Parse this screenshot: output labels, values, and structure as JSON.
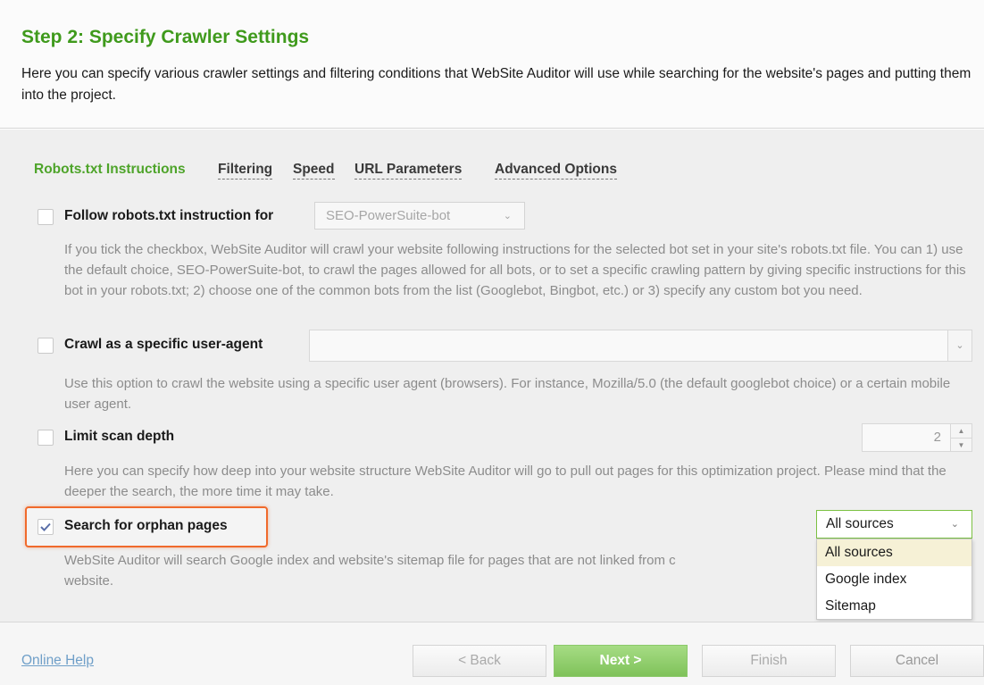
{
  "header": {
    "title": "Step 2: Specify Crawler Settings",
    "description": "Here you can specify various crawler settings and filtering conditions that WebSite Auditor will use while searching for the website's pages and putting them into the project."
  },
  "tabs": [
    {
      "label": "Robots.txt Instructions",
      "active": true
    },
    {
      "label": "Filtering",
      "active": false
    },
    {
      "label": "Speed",
      "active": false
    },
    {
      "label": "URL Parameters",
      "active": false
    },
    {
      "label": "Advanced Options",
      "active": false
    }
  ],
  "options": {
    "robots": {
      "label": "Follow robots.txt instruction for",
      "checked": false,
      "select_value": "SEO-PowerSuite-bot",
      "description": "If you tick the checkbox, WebSite Auditor will crawl your website following instructions for the selected bot set in your site's robots.txt file. You can 1) use the default choice, SEO-PowerSuite-bot, to crawl the pages allowed for all bots, or to set a specific crawling pattern by giving specific instructions for this bot in your robots.txt; 2) choose one of the common bots from the list (Googlebot, Bingbot, etc.) or 3) specify any custom bot you need."
    },
    "user_agent": {
      "label": "Crawl as a specific user-agent",
      "checked": false,
      "value": "",
      "description": "Use this option to crawl the website using a specific user agent (browsers). For instance, Mozilla/5.0 (the default googlebot choice) or a certain mobile user agent."
    },
    "scan_depth": {
      "label": "Limit scan depth",
      "checked": false,
      "value": "2",
      "description": "Here you can specify how deep into  your website structure WebSite Auditor will go to pull out pages for this optimization project. Please mind that the deeper the search, the more time it may take."
    },
    "orphan": {
      "label": "Search for orphan pages",
      "checked": true,
      "select_value": "All sources",
      "description_visible": "WebSite Auditor will search Google index and website's sitemap file for pages that are not linked from c",
      "description_line2": "website.",
      "dropdown_items": [
        "All sources",
        "Google index",
        "Sitemap"
      ],
      "selected_index": 0
    }
  },
  "footer": {
    "help_link": "Online Help",
    "back": "< Back",
    "next": "Next >",
    "finish": "Finish",
    "cancel": "Cancel"
  },
  "colors": {
    "accent_green": "#3f9a1c",
    "highlight_orange": "#f06a2c",
    "link_blue": "#6f9fc8"
  }
}
